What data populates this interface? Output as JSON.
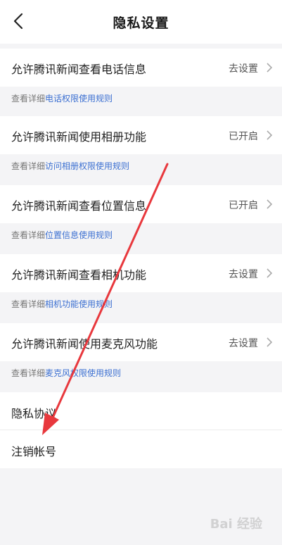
{
  "header": {
    "title": "隐私设置"
  },
  "settings": [
    {
      "label": "允许腾讯新闻查看电话信息",
      "value": "去设置",
      "hint_prefix": "查看详细",
      "hint_link": "电话权限使用规则"
    },
    {
      "label": "允许腾讯新闻使用相册功能",
      "value": "已开启",
      "hint_prefix": "查看详细",
      "hint_link": "访问相册权限使用规则"
    },
    {
      "label": "允许腾讯新闻查看位置信息",
      "value": "已开启",
      "hint_prefix": "查看详细",
      "hint_link": "位置信息使用规则"
    },
    {
      "label": "允许腾讯新闻查看相机功能",
      "value": "去设置",
      "hint_prefix": "查看详细",
      "hint_link": "相机功能使用规则"
    },
    {
      "label": "允许腾讯新闻使用麦克风功能",
      "value": "去设置",
      "hint_prefix": "查看详细",
      "hint_link": "麦克风权限使用规则"
    }
  ],
  "extra": {
    "privacy_label": "隐私协议",
    "cancel_account_label": "注销帐号"
  },
  "watermark": {
    "text": "Bai 经验"
  },
  "colors": {
    "accent_link": "#3b6fd1",
    "arrow": "#e8383d"
  }
}
